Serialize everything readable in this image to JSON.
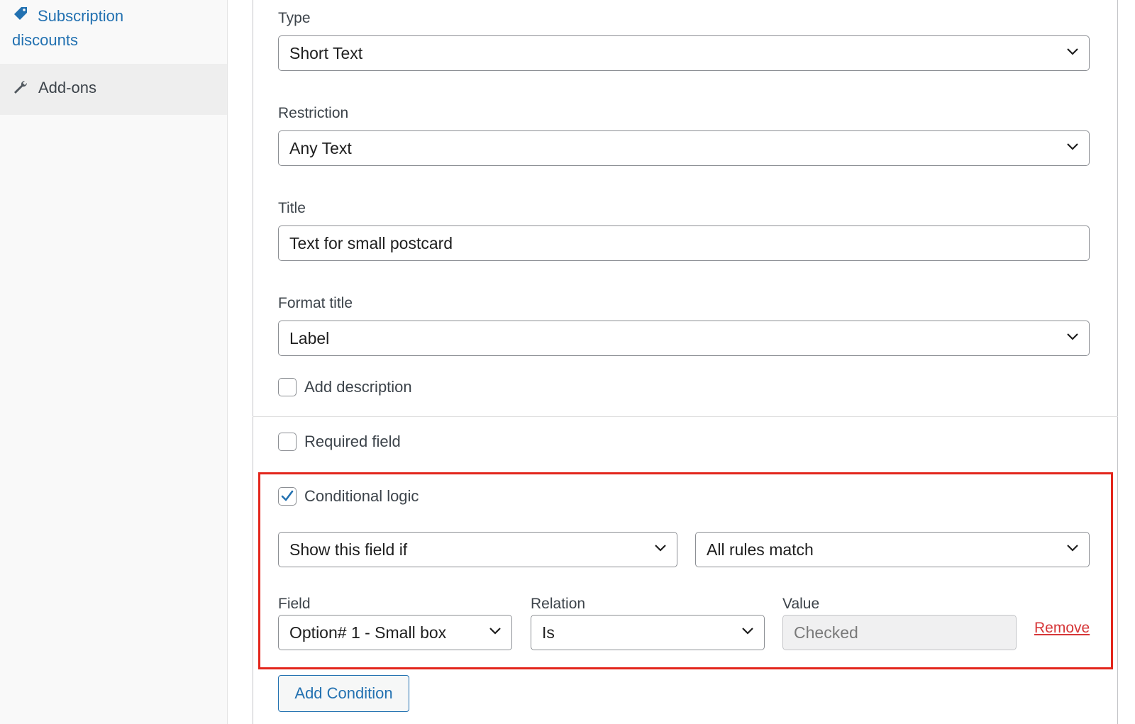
{
  "sidebar": {
    "items": [
      {
        "label": "Subscription discounts",
        "icon": "tag-icon"
      },
      {
        "label": "Add-ons",
        "icon": "wrench-icon"
      }
    ]
  },
  "form": {
    "type": {
      "label": "Type",
      "value": "Short Text"
    },
    "restriction": {
      "label": "Restriction",
      "value": "Any Text"
    },
    "title": {
      "label": "Title",
      "value": "Text for small postcard"
    },
    "format_title": {
      "label": "Format title",
      "value": "Label"
    },
    "add_description": {
      "label": "Add description",
      "checked": false
    },
    "required_field": {
      "label": "Required field",
      "checked": false
    },
    "conditional_logic": {
      "label": "Conditional logic",
      "checked": true,
      "visibility": "Show this field if",
      "match": "All rules match",
      "rule": {
        "field_label": "Field",
        "field_value": "Option# 1 - Small box",
        "relation_label": "Relation",
        "relation_value": "Is",
        "value_label": "Value",
        "value_value": "Checked",
        "remove_label": "Remove"
      },
      "add_condition_label": "Add Condition"
    }
  },
  "colors": {
    "link": "#2271b1",
    "highlight_border": "#e3261c",
    "remove": "#d63638",
    "sidebar_bg": "#f9f9f9",
    "active_item_bg": "#eeeeee"
  }
}
